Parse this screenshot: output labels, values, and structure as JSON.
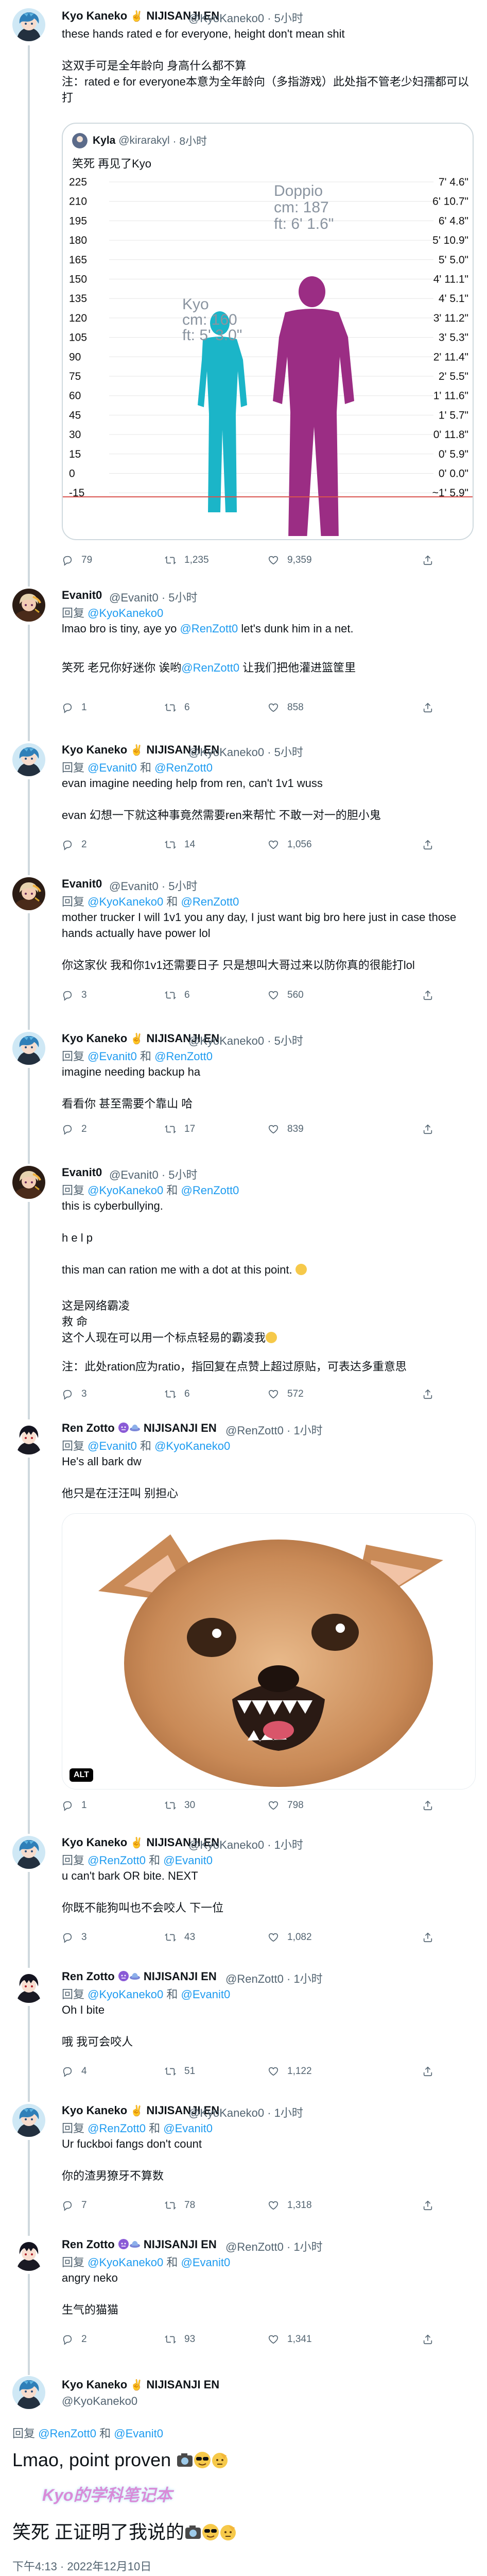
{
  "tweets": [
    {
      "name": "Kyo Kaneko",
      "emoji": "✌️",
      "org": "NIJISANJI EN",
      "handle": "@KyoKaneko0",
      "time": "· 5小时",
      "text": "these hands rated e for everyone, height don't mean shit\n\n这双手可是全年龄向 身高什么都不算\n注：rated e for everyone本意为全年龄向（多指游戏）此处指不管老少妇孺都可以打",
      "stats": {
        "replies": "79",
        "retweets": "1,235",
        "likes": "9,359"
      }
    },
    {
      "name": "Evanit0",
      "handle": "@Evanit0",
      "time": "· 5小时",
      "reply_label": "回复",
      "reply_to": "@KyoKaneko0",
      "text_prefix": "lmao bro is tiny, aye yo ",
      "text_mention": "@RenZott0",
      "text_suffix": " let's dunk him in a net.",
      "translation_prefix": "笑死 老兄你好迷你 诶哟",
      "translation_mention": "@RenZott0",
      "translation_suffix": " 让我们把他灌进篮筐里",
      "stats": {
        "replies": "1",
        "retweets": "6",
        "likes": "858"
      }
    },
    {
      "name": "Kyo Kaneko",
      "emoji": "✌️",
      "org": "NIJISANJI EN",
      "handle": "@KyoKaneko0",
      "time": "· 5小时",
      "reply_label": "回复",
      "reply_to": "@Evanit0",
      "reply_and": "和",
      "reply_to2": "@RenZott0",
      "text": "evan imagine needing help from ren, can't 1v1 wuss\n\nevan 幻想一下就这种事竟然需要ren来帮忙 不敢一对一的胆小鬼",
      "stats": {
        "replies": "2",
        "retweets": "14",
        "likes": "1,056"
      }
    },
    {
      "name": "Evanit0",
      "handle": "@Evanit0",
      "time": "· 5小时",
      "reply_label": "回复",
      "reply_to": "@KyoKaneko0",
      "reply_and": "和",
      "reply_to2": "@RenZott0",
      "text": "mother trucker I will 1v1 you any day, I just want big bro here just in case those hands actually have power lol\n\n你这家伙 我和你1v1还需要日子 只是想叫大哥过来以防你真的很能打lol",
      "stats": {
        "replies": "3",
        "retweets": "6",
        "likes": "560"
      }
    },
    {
      "name": "Kyo Kaneko",
      "emoji": "✌️",
      "org": "NIJISANJI EN",
      "handle": "@KyoKaneko0",
      "time": "· 5小时",
      "reply_label": "回复",
      "reply_to": "@Evanit0",
      "reply_and": "和",
      "reply_to2": "@RenZott0",
      "text": "imagine needing backup ha\n\n看看你 甚至需要个靠山 哈",
      "stats": {
        "replies": "2",
        "retweets": "17",
        "likes": "839"
      }
    },
    {
      "name": "Evanit0",
      "handle": "@Evanit0",
      "time": "· 5小时",
      "reply_label": "回复",
      "reply_to": "@KyoKaneko0",
      "reply_and": "和",
      "reply_to2": "@RenZott0",
      "text_a": "this is cyberbullying.\n\nh e l p\n\nthis man can ration me with a dot at this point.",
      "text_b": "这是网络霸凌\n救 命\n这个人现在可以用一个标点轻易的霸凌我",
      "text_c": "注：此处ration应为ratio，指回复在点赞上超过原贴，可表达多重意思",
      "stats": {
        "replies": "3",
        "retweets": "6",
        "likes": "572"
      }
    },
    {
      "name": "Ren Zotto",
      "org": "NIJISANJI EN",
      "handle": "@RenZott0",
      "time": "· 1小时",
      "reply_label": "回复",
      "reply_to": "@Evanit0",
      "reply_and": "和",
      "reply_to2": "@KyoKaneko0",
      "text": "He's all bark dw\n\n他只是在汪汪叫 别担心",
      "alt_badge": "ALT",
      "stats": {
        "replies": "1",
        "retweets": "30",
        "likes": "798"
      }
    },
    {
      "name": "Kyo Kaneko",
      "emoji": "✌️",
      "org": "NIJISANJI EN",
      "handle": "@KyoKaneko0",
      "time": "· 1小时",
      "reply_label": "回复",
      "reply_to": "@RenZott0",
      "reply_and": "和",
      "reply_to2": "@Evanit0",
      "text": "u can't bark OR bite. NEXT\n\n你既不能狗叫也不会咬人 下一位",
      "stats": {
        "replies": "3",
        "retweets": "43",
        "likes": "1,082"
      }
    },
    {
      "name": "Ren Zotto",
      "org": "NIJISANJI EN",
      "handle": "@RenZott0",
      "time": "· 1小时",
      "reply_label": "回复",
      "reply_to": "@KyoKaneko0",
      "reply_and": "和",
      "reply_to2": "@Evanit0",
      "text": "Oh I bite\n\n哦 我可会咬人",
      "stats": {
        "replies": "4",
        "retweets": "51",
        "likes": "1,122"
      }
    },
    {
      "name": "Kyo Kaneko",
      "emoji": "✌️",
      "org": "NIJISANJI EN",
      "handle": "@KyoKaneko0",
      "time": "· 1小时",
      "reply_label": "回复",
      "reply_to": "@RenZott0",
      "reply_and": "和",
      "reply_to2": "@Evanit0",
      "text": "Ur fuckboi fangs don't count\n\n你的渣男獠牙不算数",
      "stats": {
        "replies": "7",
        "retweets": "78",
        "likes": "1,318"
      }
    },
    {
      "name": "Ren Zotto",
      "org": "NIJISANJI EN",
      "handle": "@RenZott0",
      "time": "· 1小时",
      "reply_label": "回复",
      "reply_to": "@KyoKaneko0",
      "reply_and": "和",
      "reply_to2": "@Evanit0",
      "text": "angry neko\n\n生气的猫猫",
      "stats": {
        "replies": "2",
        "retweets": "93",
        "likes": "1,341"
      }
    }
  ],
  "quote": {
    "name": "Kyla",
    "handle": "@kirarakyl",
    "time": "· 8小时",
    "text": "笑死 再见了Kyo"
  },
  "height_chart": {
    "left_ticks": [
      "225",
      "210",
      "195",
      "180",
      "165",
      "150",
      "135",
      "120",
      "105",
      "90",
      "75",
      "60",
      "45",
      "30",
      "15",
      "0",
      "-15"
    ],
    "right_ticks": [
      "7' 4.6\"",
      "6' 10.7\"",
      "6' 4.8\"",
      "5' 10.9\"",
      "5' 5.0\"",
      "4' 11.1\"",
      "4' 5.1\"",
      "3' 11.2\"",
      "3' 5.3\"",
      "2' 11.4\"",
      "2' 5.5\"",
      "1' 11.6\"",
      "1' 5.7\"",
      "0' 11.8\"",
      "0' 5.9\"",
      "0' 0.0\"",
      "~1' 5.9\""
    ],
    "kyo_name": "Kyo",
    "kyo_cm": "cm: 160",
    "kyo_ft": "ft: 5' 3.0\"",
    "dop_name": "Doppio",
    "dop_cm": "cm: 187",
    "dop_ft": "ft: 6' 1.6\"",
    "kyo_color": "#1bb5c8",
    "dop_color": "#9b2d84"
  },
  "main": {
    "name": "Kyo Kaneko",
    "emoji": "✌️",
    "org": "NIJISANJI EN",
    "handle": "@KyoKaneko0",
    "reply_label": "回复",
    "reply_to": "@RenZott0",
    "reply_and": "和",
    "reply_to2": "@Evanit0",
    "text": "Lmao, point proven",
    "watermark": "Kyo的学科笔记本",
    "translation": "笑死 正证明了我说的",
    "timestamp": "下午4:13 · 2022年12月10日"
  },
  "colors": {
    "link": "#1d9bf0",
    "muted": "#536471",
    "line": "#cfd9de",
    "alt_bg": "#000000"
  }
}
